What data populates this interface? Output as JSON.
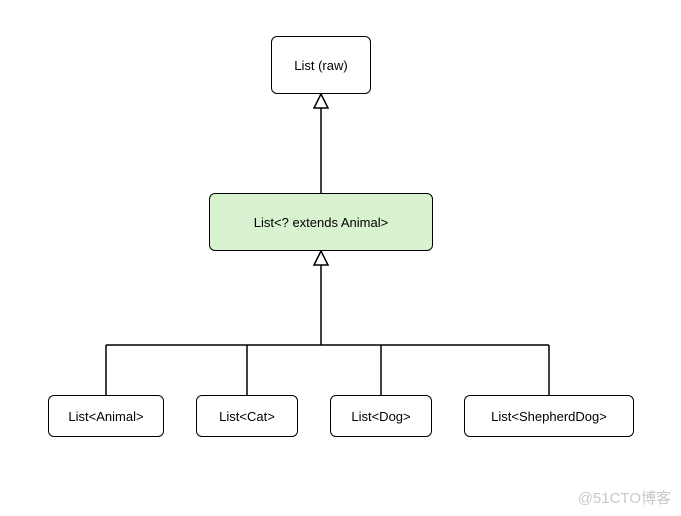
{
  "diagram": {
    "top": {
      "label": "List (raw)"
    },
    "mid": {
      "label": "List<? extends Animal>"
    },
    "bottom": [
      {
        "label": "List<Animal>"
      },
      {
        "label": "List<Cat>"
      },
      {
        "label": "List<Dog>"
      },
      {
        "label": "List<ShepherdDog>"
      }
    ]
  },
  "watermark": "@51CTO博客"
}
